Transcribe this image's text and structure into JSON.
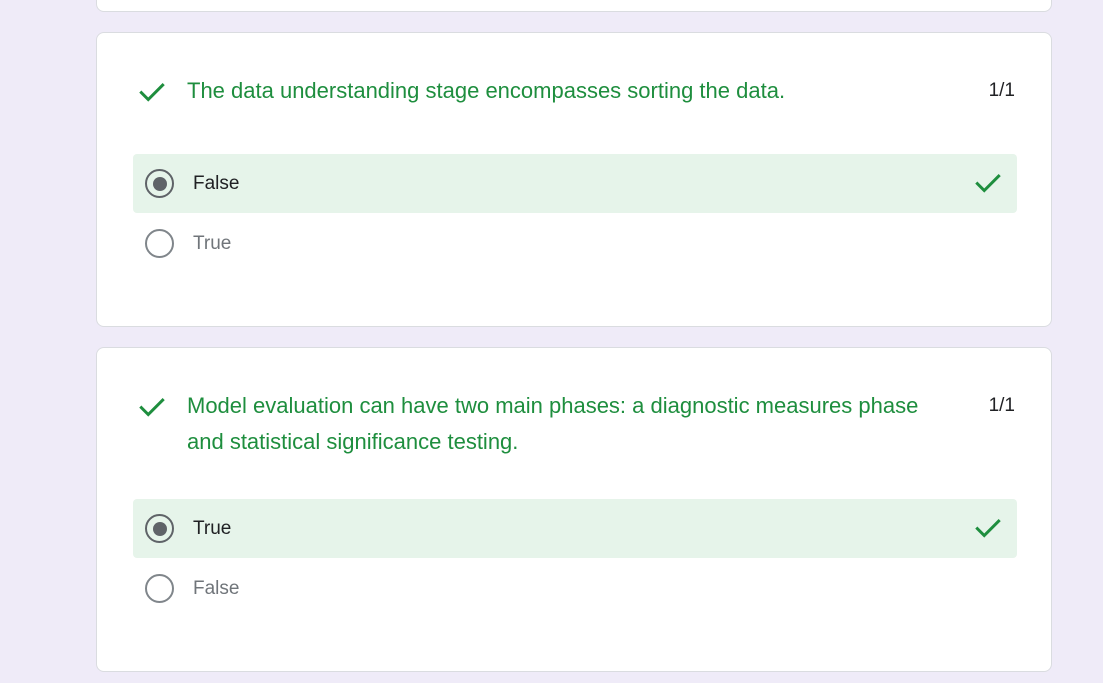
{
  "colors": {
    "background": "#efebf8",
    "correct_green": "#1e8e3e",
    "selected_bg": "#e6f4ea"
  },
  "questions": [
    {
      "text": "The data understanding stage encompasses sorting the data.",
      "score": "1/1",
      "status_icon": "check-icon",
      "options": [
        {
          "label": "False",
          "selected": true,
          "correct": true
        },
        {
          "label": "True",
          "selected": false,
          "correct": false
        }
      ]
    },
    {
      "text": "Model evaluation can have two main phases: a diagnostic measures phase and statistical significance testing.",
      "score": "1/1",
      "status_icon": "check-icon",
      "options": [
        {
          "label": "True",
          "selected": true,
          "correct": true
        },
        {
          "label": "False",
          "selected": false,
          "correct": false
        }
      ]
    }
  ]
}
